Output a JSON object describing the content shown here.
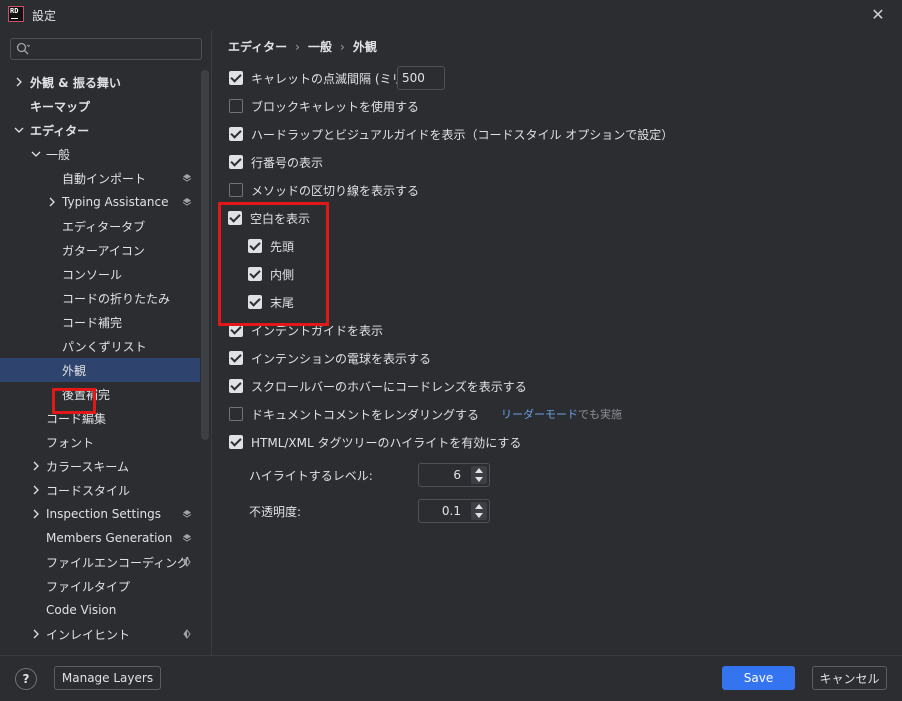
{
  "window": {
    "title": "設定",
    "logo_text": "RD"
  },
  "search": {
    "value": "",
    "placeholder": ""
  },
  "sidebar": {
    "items": [
      {
        "label": "外観 & 振る舞い",
        "bold": true
      },
      {
        "label": "キーマップ",
        "bold": true
      },
      {
        "label": "エディター",
        "bold": true
      },
      {
        "label": "一般"
      },
      {
        "label": "自動インポート"
      },
      {
        "label": "Typing Assistance"
      },
      {
        "label": "エディタータブ"
      },
      {
        "label": "ガターアイコン"
      },
      {
        "label": "コンソール"
      },
      {
        "label": "コードの折りたたみ"
      },
      {
        "label": "コード補完"
      },
      {
        "label": "パンくずリスト"
      },
      {
        "label": "外観",
        "selected": true
      },
      {
        "label": "後置補完"
      },
      {
        "label": "コード編集"
      },
      {
        "label": "フォント"
      },
      {
        "label": "カラースキーム"
      },
      {
        "label": "コードスタイル"
      },
      {
        "label": "Inspection Settings"
      },
      {
        "label": "Members Generation"
      },
      {
        "label": "ファイルエンコーディング"
      },
      {
        "label": "ファイルタイプ"
      },
      {
        "label": "Code Vision"
      },
      {
        "label": "インレイヒント"
      }
    ]
  },
  "breadcrumb": [
    "エディター",
    "一般",
    "外観"
  ],
  "options": {
    "caret_blink": {
      "label": "キャレットの点滅間隔 (ミリ秒):",
      "checked": true,
      "value": "500"
    },
    "block_caret": {
      "label": "ブロックキャレットを使用する",
      "checked": false
    },
    "hard_wrap": {
      "label": "ハードラップとビジュアルガイドを表示（コードスタイル オプションで設定）",
      "checked": true
    },
    "line_numbers": {
      "label": "行番号の表示",
      "checked": true
    },
    "method_separators": {
      "label": "メソッドの区切り線を表示する",
      "checked": false
    },
    "whitespace": {
      "label": "空白を表示",
      "checked": true
    },
    "ws_leading": {
      "label": "先頭",
      "checked": true
    },
    "ws_inner": {
      "label": "内側",
      "checked": true
    },
    "ws_trailing": {
      "label": "末尾",
      "checked": true
    },
    "indent_guides": {
      "label": "インデントガイドを表示",
      "checked": true
    },
    "intention_bulb": {
      "label": "インテンションの電球を表示する",
      "checked": true
    },
    "code_lens": {
      "label": "スクロールバーのホバーにコードレンズを表示する",
      "checked": true
    },
    "render_docs": {
      "label": "ドキュメントコメントをレンダリングする",
      "checked": false,
      "note_link": "リーダーモード",
      "note_text": "でも実施"
    },
    "html_tree": {
      "label": "HTML/XML タグツリーのハイライトを有効にする",
      "checked": true
    },
    "highlight_levels": {
      "label": "ハイライトするレベル:",
      "value": "6"
    },
    "opacity": {
      "label": "不透明度:",
      "value": "0.1"
    }
  },
  "footer": {
    "help": "?",
    "manage_layers": "Manage Layers",
    "save": "Save",
    "cancel": "キャンセル"
  },
  "colors": {
    "accent": "#3574f0",
    "selection": "#2e436e",
    "highlight_box": "#e01818",
    "background": "#2b2d30"
  }
}
